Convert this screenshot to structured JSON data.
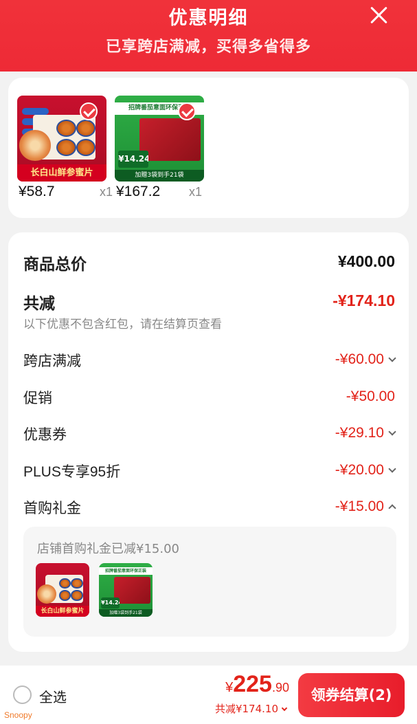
{
  "header": {
    "title": "优惠明细",
    "subtitle": "已享跨店满减，买得多省得多"
  },
  "products": [
    {
      "name_tag": "长白山鲜参蜜片",
      "price": "¥58.7",
      "qty": "x1",
      "selected": true
    },
    {
      "name_tag": "招牌番茄意面环保正装",
      "price_tag": "¥14.24",
      "footer_tag": "加赠3袋到手21袋",
      "price": "¥167.2",
      "qty": "x1",
      "selected": true
    }
  ],
  "summary": {
    "subtotal_label": "商品总价",
    "subtotal_value": "¥400.00",
    "total_discount_label": "共减",
    "total_discount_value": "-¥174.10",
    "note": "以下优惠不包含红包，请在结算页查看",
    "discounts": [
      {
        "label": "跨店满减",
        "value": "-¥60.00",
        "expand": "down"
      },
      {
        "label": "促销",
        "value": "-¥50.00",
        "expand": "none"
      },
      {
        "label": "优惠券",
        "value": "-¥29.10",
        "expand": "down"
      },
      {
        "label": "PLUS专享95折",
        "value": "-¥20.00",
        "expand": "down"
      },
      {
        "label": "首购礼金",
        "value": "-¥15.00",
        "expand": "up"
      }
    ],
    "gift_panel": {
      "text": "店铺首购礼金已减¥15.00"
    }
  },
  "bottom_bar": {
    "select_all_label": "全选",
    "total_currency": "¥",
    "total_integer": "225",
    "total_decimal": ".90",
    "total_saving": "共减¥174.10",
    "checkout_label": "领券结算(2)"
  },
  "watermark": "Snoopy",
  "colors": {
    "accent": "#e2231a",
    "header_bg": "#ee2a36",
    "checkout_bg": "#e81d2b"
  }
}
